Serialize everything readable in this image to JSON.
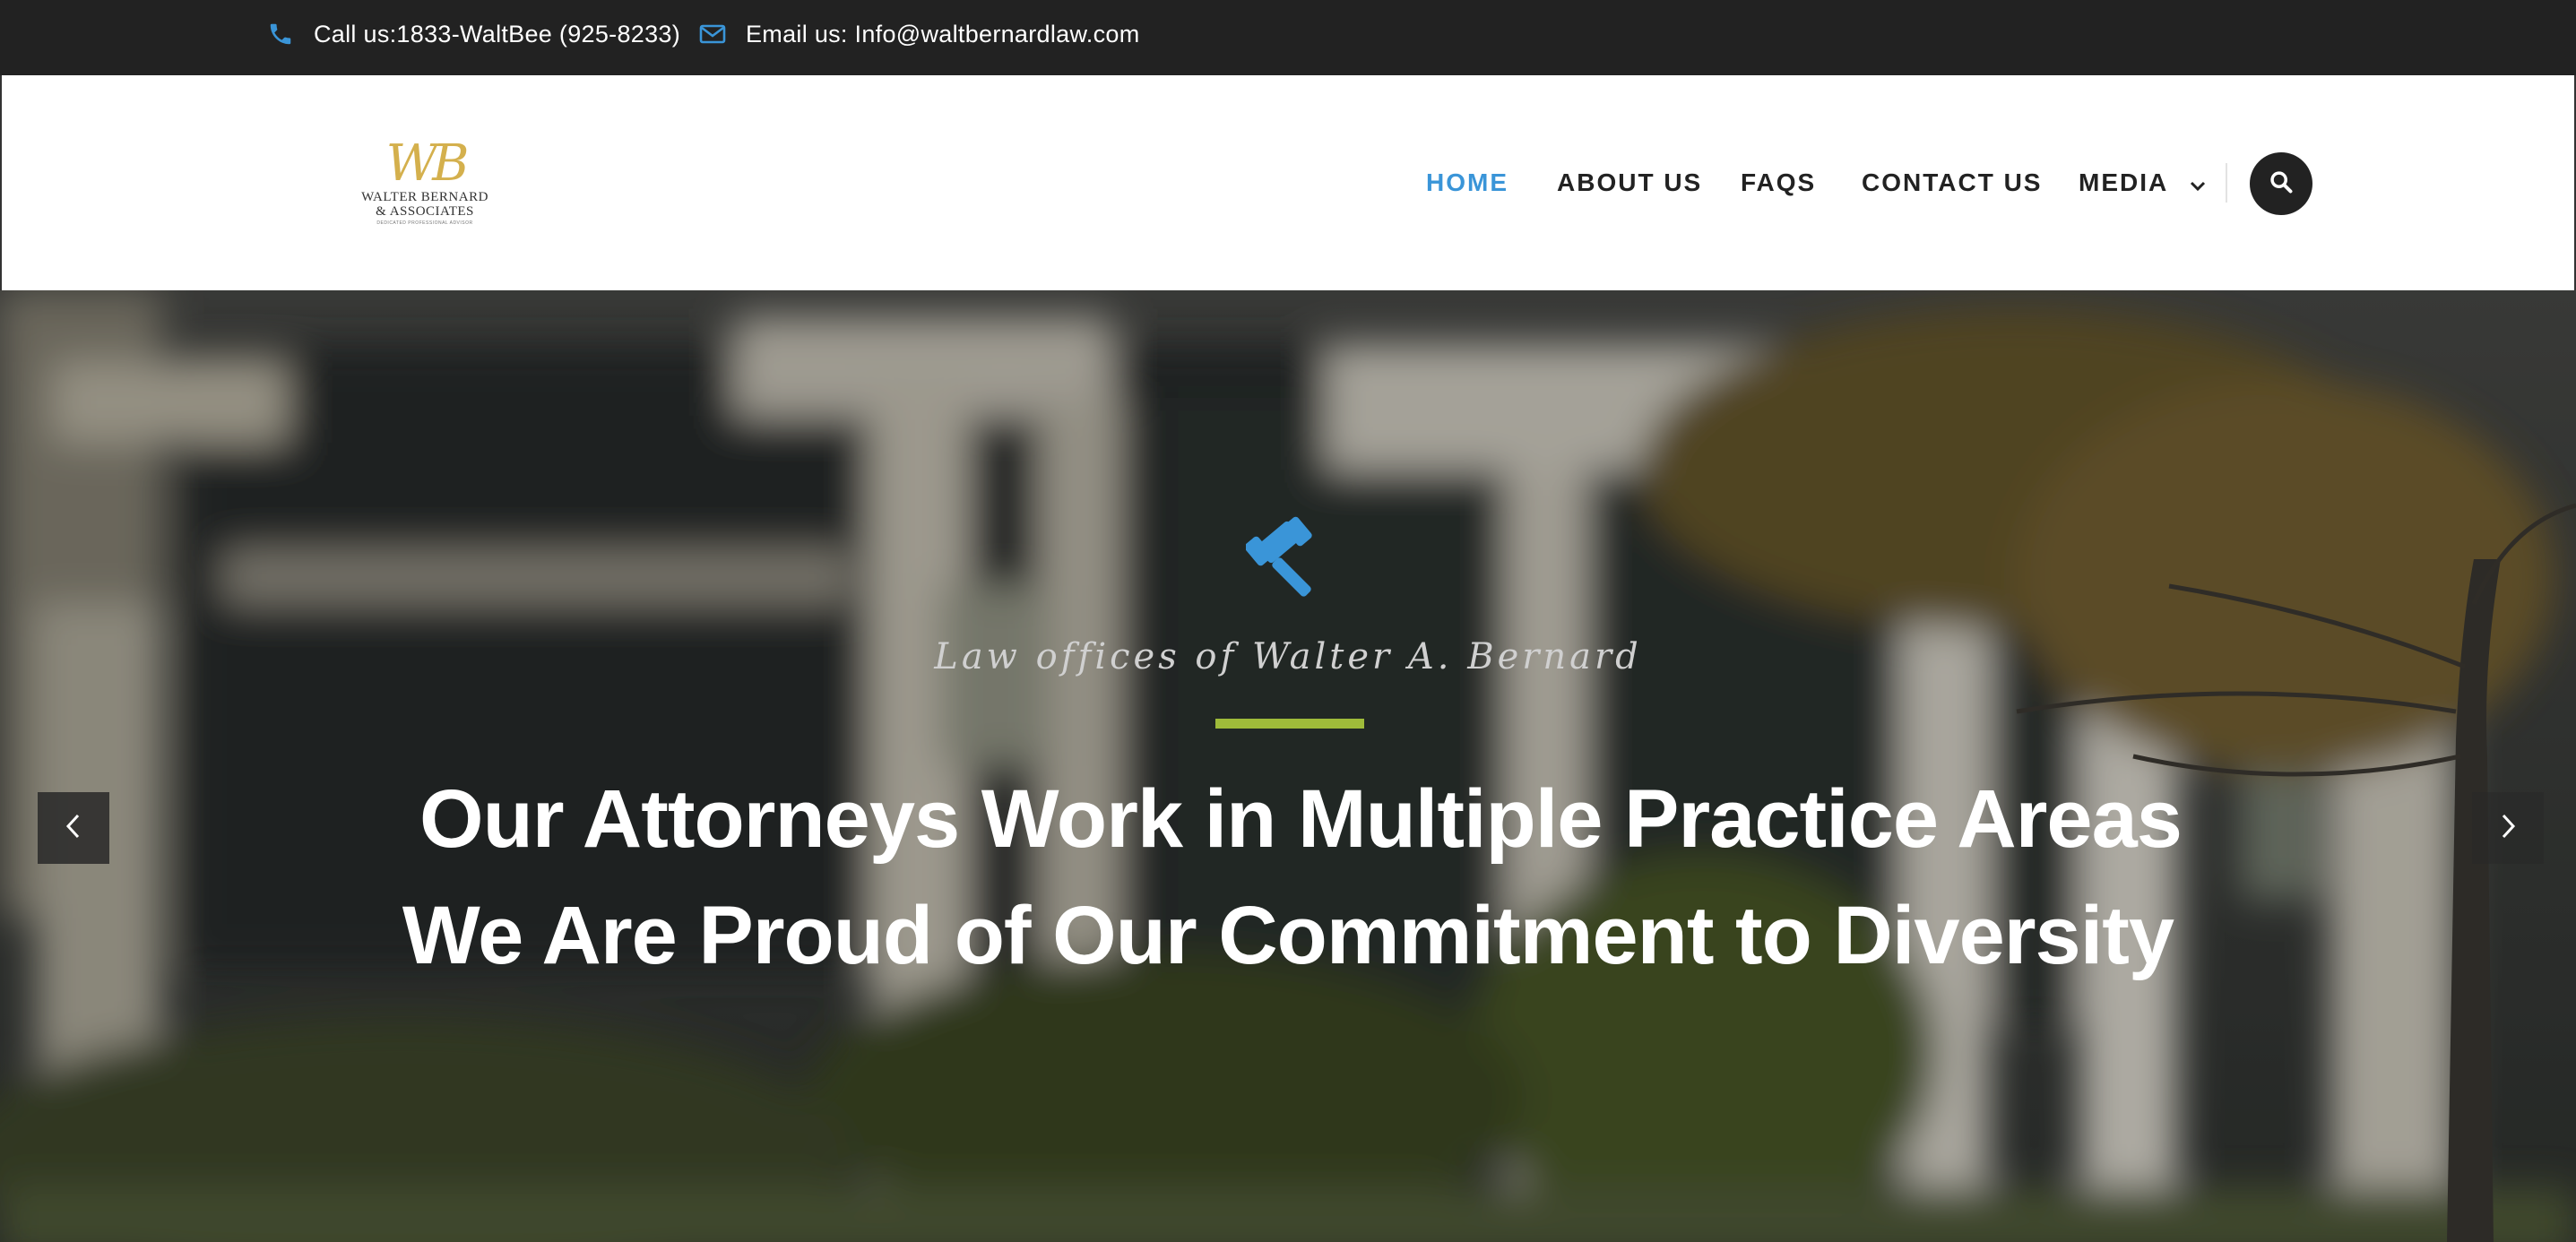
{
  "topbar": {
    "phone_text": "Call us:1833-WaltBee (925-8233)",
    "email_text": "Email us: Info@waltbernardlaw.com",
    "icon_color": "#3a95d8",
    "phone_icon": "phone-icon",
    "email_icon": "envelope-icon"
  },
  "logo": {
    "mark": "WB",
    "name_line1": "WALTER BERNARD",
    "name_line2": "& ASSOCIATES",
    "tagline": "DEDICATED PROFESSIONAL ADVISOR"
  },
  "nav": {
    "items": [
      {
        "label": "HOME",
        "active": true
      },
      {
        "label": "ABOUT US",
        "active": false
      },
      {
        "label": "FAQS",
        "active": false
      },
      {
        "label": "CONTACT US",
        "active": false
      },
      {
        "label": "MEDIA",
        "active": false,
        "dropdown": true
      }
    ],
    "active_color": "#3a95d8",
    "search_icon": "search-icon"
  },
  "hero": {
    "icon": "gavel-icon",
    "subtitle": "Law offices of Walter A. Bernard",
    "accent_color": "#9fbb3a",
    "headline_line1": "Our Attorneys Work in Multiple Practice Areas",
    "headline_line2": "We Are Proud of Our Commitment to Diversity",
    "prev_icon": "chevron-left-icon",
    "next_icon": "chevron-right-icon"
  }
}
